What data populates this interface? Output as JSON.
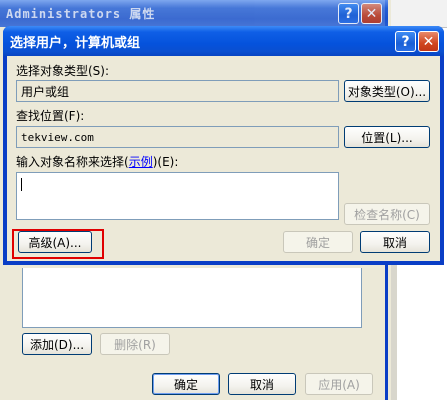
{
  "background_window": {
    "title": "Administrators 属性",
    "help_glyph": "?",
    "close_glyph": "✕",
    "add_button": "添加(D)...",
    "remove_button": "删除(R)",
    "ok_button": "确定",
    "cancel_button": "取消",
    "apply_button": "应用(A)"
  },
  "dialog": {
    "title": "选择用户，计算机或组",
    "help_glyph": "?",
    "close_glyph": "✕",
    "object_type_label": "选择对象类型(S):",
    "object_type_value": "用户或组",
    "object_type_button": "对象类型(O)...",
    "location_label": "查找位置(F):",
    "location_value": "tekview.com",
    "location_button": "位置(L)...",
    "names_label_prefix": "输入对象名称来选择(",
    "names_label_link": "示例",
    "names_label_suffix": ")(E):",
    "check_names_button": "检查名称(C)",
    "advanced_button": "高级(A)...",
    "ok_button": "确定",
    "cancel_button": "取消"
  },
  "colors": {
    "title_blue": "#0552dc",
    "highlight": "#e00000",
    "dialog_face": "#ece9d8"
  }
}
